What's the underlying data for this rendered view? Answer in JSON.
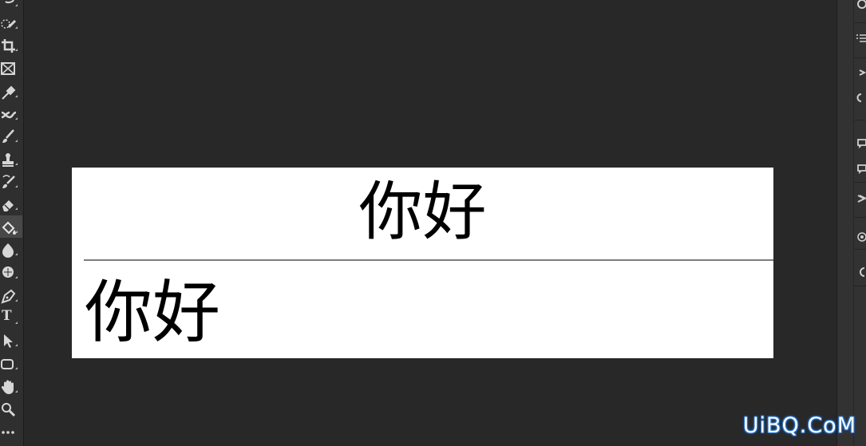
{
  "toolbar": {
    "tools": [
      {
        "name": "lasso-tool-icon"
      },
      {
        "name": "quick-selection-tool-icon"
      },
      {
        "name": "crop-tool-icon"
      },
      {
        "name": "frame-tool-icon"
      },
      {
        "name": "eyedropper-tool-icon"
      },
      {
        "name": "healing-brush-tool-icon"
      },
      {
        "name": "brush-tool-icon"
      },
      {
        "name": "clone-stamp-tool-icon"
      },
      {
        "name": "history-brush-tool-icon"
      },
      {
        "name": "eraser-tool-icon"
      },
      {
        "name": "paint-bucket-tool-icon",
        "active": true
      },
      {
        "name": "blur-tool-icon"
      },
      {
        "name": "dodge-tool-icon"
      },
      {
        "name": "pen-tool-icon"
      },
      {
        "name": "type-tool-icon",
        "glyph": "T"
      },
      {
        "name": "path-selection-tool-icon"
      },
      {
        "name": "rectangle-tool-icon"
      },
      {
        "name": "hand-tool-icon"
      },
      {
        "name": "zoom-tool-icon"
      },
      {
        "name": "more-tools-icon"
      }
    ]
  },
  "canvas": {
    "top_text": "你好",
    "bottom_text": "你好",
    "background": "#ffffff",
    "divider_color": "#7c7c7c"
  },
  "workspace_background": "#282828",
  "right_panel": {
    "icons": [
      "panel-icon-a",
      "paragraph-icon",
      "layers-icon",
      "properties-icon",
      "comment-icon",
      "channels-icon",
      "adjustments-icon",
      "libraries-icon",
      "paths-icon"
    ]
  },
  "watermark": {
    "text": "UiBQ.CoM",
    "color": "#2a7ad0"
  }
}
